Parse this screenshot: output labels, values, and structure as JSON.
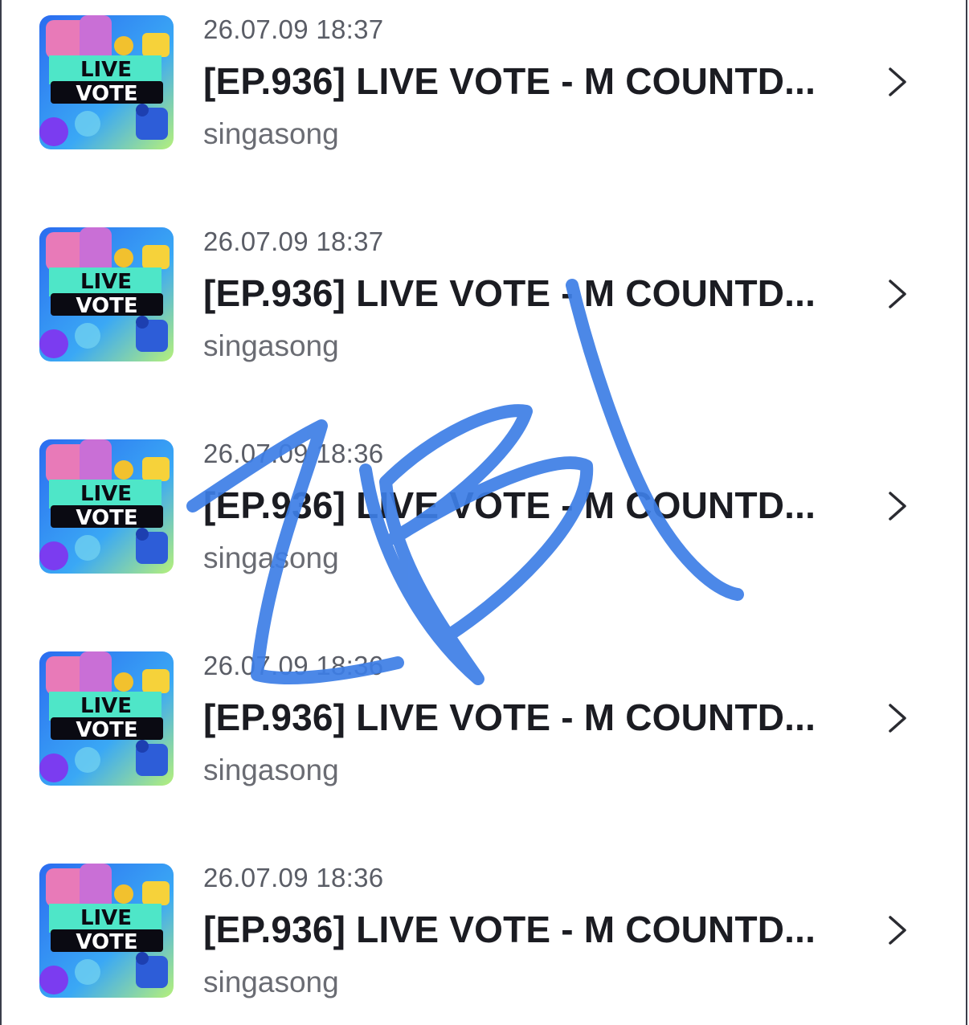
{
  "items": [
    {
      "timestamp": "26.07.09 18:37",
      "title": "[EP.936] LIVE VOTE - M COUNTD...",
      "channel": "singasong",
      "thumb_line1": "LIVE",
      "thumb_line2": "VOTE"
    },
    {
      "timestamp": "26.07.09 18:37",
      "title": "[EP.936] LIVE VOTE - M COUNTD...",
      "channel": "singasong",
      "thumb_line1": "LIVE",
      "thumb_line2": "VOTE"
    },
    {
      "timestamp": "26.07.09 18:36",
      "title": "[EP.936] LIVE VOTE - M COUNTD...",
      "channel": "singasong",
      "thumb_line1": "LIVE",
      "thumb_line2": "VOTE"
    },
    {
      "timestamp": "26.07.09 18:36",
      "title": "[EP.936] LIVE VOTE - M COUNTD...",
      "channel": "singasong",
      "thumb_line1": "LIVE",
      "thumb_line2": "VOTE"
    },
    {
      "timestamp": "26.07.09 18:36",
      "title": "[EP.936] LIVE VOTE - M COUNTD...",
      "channel": "singasong",
      "thumb_line1": "LIVE",
      "thumb_line2": "VOTE"
    }
  ],
  "icons": {
    "row_action": "chevron-right-icon",
    "overlay": "handwritten-scribble"
  },
  "colors": {
    "title": "#1b1c22",
    "meta": "#5a5d66",
    "scribble": "#3d7ee6",
    "thumb_banner": "#4ee6c8"
  }
}
